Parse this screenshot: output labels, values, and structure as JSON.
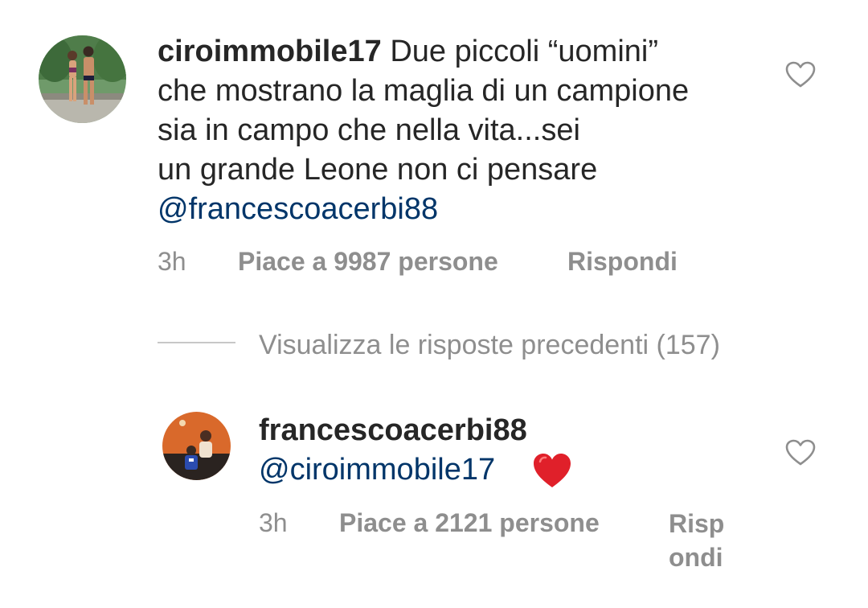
{
  "comment": {
    "username": "ciroimmobile17",
    "text_lines": [
      "Due piccoli “uomini”",
      "che mostrano la maglia di un campione",
      "sia in campo che nella vita...sei",
      "un grande Leone non ci pensare"
    ],
    "mention": "@francescoacerbi88",
    "time": "3h",
    "likes_label": "Piace a 9987 persone",
    "reply_label": "Rispondi",
    "like_icon": "heart-outline-icon"
  },
  "view_replies": {
    "label": "Visualizza le risposte precedenti (157)"
  },
  "reply": {
    "username": "francescoacerbi88",
    "mention": "@ciroimmobile17",
    "emoji": "red-heart",
    "time": "3h",
    "likes_label": "Piace a 2121 persone",
    "reply_label": "Rispondi",
    "like_icon": "heart-outline-icon"
  },
  "colors": {
    "text": "#262626",
    "meta": "#8e8e8e",
    "mention": "#003569",
    "divider": "#c7c7c7",
    "heart": "#ed1c24"
  }
}
